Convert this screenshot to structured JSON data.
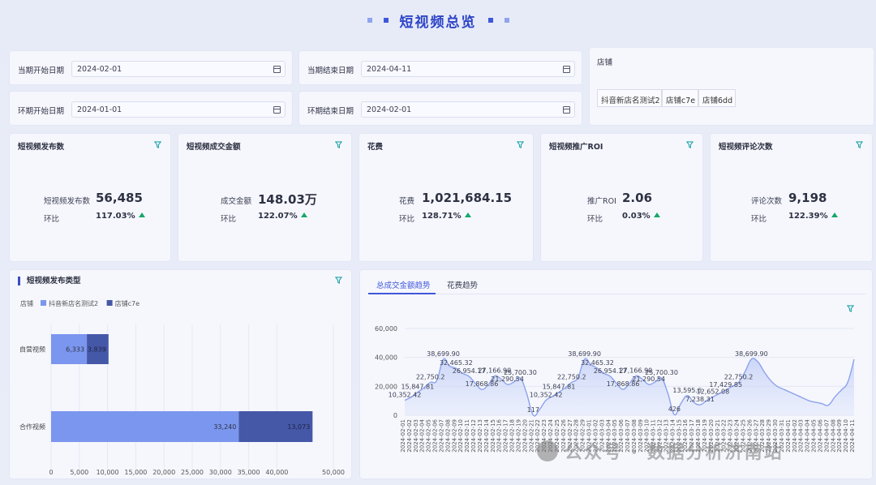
{
  "page_title": "短视频总览",
  "filters": {
    "current_start_label": "当期开始日期",
    "current_start_value": "2024-02-01",
    "current_end_label": "当期结束日期",
    "current_end_value": "2024-04-11",
    "prev_start_label": "环期开始日期",
    "prev_start_value": "2024-01-01",
    "prev_end_label": "环期结束日期",
    "prev_end_value": "2024-02-01"
  },
  "store": {
    "title": "店铺",
    "options": [
      "抖音新店名测试2",
      "店铺c7e",
      "店铺6dd"
    ]
  },
  "kpis": [
    {
      "title": "短视频发布数",
      "label": "短视频发布数",
      "value": "56,485",
      "ratio_label": "环比",
      "ratio": "117.03%"
    },
    {
      "title": "短视频成交金额",
      "label": "成交金额",
      "value": "148.03万",
      "ratio_label": "环比",
      "ratio": "122.07%"
    },
    {
      "title": "花费",
      "label": "花费",
      "value": "1,021,684.15",
      "ratio_label": "环比",
      "ratio": "128.71%"
    },
    {
      "title": "短视频推广ROI",
      "label": "推广ROI",
      "value": "2.06",
      "ratio_label": "环比",
      "ratio": "0.03%"
    },
    {
      "title": "短视频评论次数",
      "label": "评论次数",
      "value": "9,198",
      "ratio_label": "环比",
      "ratio": "122.39%"
    }
  ],
  "bar_section": {
    "title": "短视频发布类型",
    "legend_title": "店铺"
  },
  "trend_section": {
    "tabs": [
      "总成交金额趋势",
      "花费趋势"
    ],
    "active_tab": 0
  },
  "watermark": "公众号 · 数据分析济南站",
  "colors": {
    "series1": "#7b96ee",
    "series2": "#4558a8",
    "line": "#8ca3ec",
    "accent": "#3f58d9",
    "up": "#16a86a"
  },
  "chart_data": [
    {
      "type": "bar",
      "orientation": "horizontal",
      "stacked": true,
      "categories": [
        "自营视频",
        "合作视频"
      ],
      "series": [
        {
          "name": "抖音新店名测试2",
          "values": [
            6333,
            33240
          ]
        },
        {
          "name": "店铺c7e",
          "values": [
            3839,
            13073
          ]
        }
      ],
      "data_labels": [
        [
          "6,333",
          "33,240"
        ],
        [
          "3,839",
          "13,073"
        ]
      ],
      "xlim": [
        0,
        50000
      ],
      "xticks": [
        "0",
        "5,000",
        "10,000",
        "15,000",
        "20,000",
        "25,000",
        "30,000",
        "35,000",
        "40,000",
        "50,000"
      ],
      "xtick_values": [
        0,
        5000,
        10000,
        15000,
        20000,
        25000,
        30000,
        35000,
        40000,
        50000
      ],
      "legend": "top-left",
      "grid": true
    },
    {
      "type": "area",
      "ylim": [
        0,
        60000
      ],
      "yticks": [
        "0",
        "20,000",
        "40,000",
        "60,000"
      ],
      "ytick_values": [
        0,
        20000,
        40000,
        60000
      ],
      "x": [
        "2024-02-01",
        "2024-02-02",
        "2024-02-03",
        "2024-02-04",
        "2024-02-05",
        "2024-02-06",
        "2024-02-07",
        "2024-02-08",
        "2024-02-09",
        "2024-02-10",
        "2024-02-11",
        "2024-02-12",
        "2024-02-13",
        "2024-02-14",
        "2024-02-15",
        "2024-02-16",
        "2024-02-17",
        "2024-02-18",
        "2024-02-19",
        "2024-02-20",
        "2024-02-21",
        "2024-02-22",
        "2024-02-23",
        "2024-02-24",
        "2024-02-25",
        "2024-02-26",
        "2024-02-27",
        "2024-02-28",
        "2024-02-29",
        "2024-03-01",
        "2024-03-02",
        "2024-03-03",
        "2024-03-04",
        "2024-03-05",
        "2024-03-06",
        "2024-03-07",
        "2024-03-08",
        "2024-03-09",
        "2024-03-10",
        "2024-03-11",
        "2024-03-12",
        "2024-03-13",
        "2024-03-14",
        "2024-03-15",
        "2024-03-16",
        "2024-03-17",
        "2024-03-18",
        "2024-03-19",
        "2024-03-20",
        "2024-03-21",
        "2024-03-22",
        "2024-03-23",
        "2024-03-24",
        "2024-03-25",
        "2024-03-26",
        "2024-03-27",
        "2024-03-28",
        "2024-03-29",
        "2024-03-30",
        "2024-03-31",
        "2024-04-01",
        "2024-04-02",
        "2024-04-03",
        "2024-04-04",
        "2024-04-05",
        "2024-04-06",
        "2024-04-07",
        "2024-04-08",
        "2024-04-09",
        "2024-04-10",
        "2024-04-11"
      ],
      "values": [
        10352.42,
        12500,
        15847.81,
        19000,
        22750.2,
        24000,
        38699.9,
        34000,
        32465.32,
        29000,
        26954.17,
        22000,
        17868.86,
        21000,
        27166.9,
        25000,
        21290.54,
        23000,
        25700.3,
        15000,
        117,
        4000,
        10352.42,
        13000,
        15847.81,
        19000,
        22750.2,
        26000,
        38699.9,
        35000,
        32465.32,
        29000,
        26954.17,
        22000,
        17868.86,
        22000,
        27166.9,
        25000,
        21290.54,
        23000,
        25700.3,
        15000,
        426,
        8000,
        13595.6,
        9000,
        7238.31,
        10000,
        12652.08,
        15000,
        17429.85,
        20000,
        22750.2,
        30000,
        38699.9,
        37000,
        30000,
        24000,
        20000,
        18000,
        16000,
        14000,
        12000,
        10000,
        9000,
        8000,
        7000,
        12652.08,
        17429.85,
        22750.2,
        38699.9
      ],
      "point_labels": [
        {
          "i": 0,
          "text": "10,352.42"
        },
        {
          "i": 2,
          "text": "15,847.81"
        },
        {
          "i": 4,
          "text": "22,750.2"
        },
        {
          "i": 6,
          "text": "38,699.90"
        },
        {
          "i": 8,
          "text": "32,465.32"
        },
        {
          "i": 10,
          "text": "26,954.17"
        },
        {
          "i": 12,
          "text": "17,868.86"
        },
        {
          "i": 14,
          "text": "27,166.90"
        },
        {
          "i": 16,
          "text": "21,290.54"
        },
        {
          "i": 18,
          "text": "25,700.30"
        },
        {
          "i": 20,
          "text": "117"
        },
        {
          "i": 22,
          "text": "10,352.42"
        },
        {
          "i": 24,
          "text": "15,847.81"
        },
        {
          "i": 26,
          "text": "22,750.2"
        },
        {
          "i": 28,
          "text": "38,699.90"
        },
        {
          "i": 30,
          "text": "32,465.32"
        },
        {
          "i": 32,
          "text": "26,954.17"
        },
        {
          "i": 34,
          "text": "17,868.86"
        },
        {
          "i": 36,
          "text": "27,166.90"
        },
        {
          "i": 38,
          "text": "21,290.54"
        },
        {
          "i": 40,
          "text": "25,700.30"
        },
        {
          "i": 42,
          "text": "426"
        },
        {
          "i": 44,
          "text": "13,595.6"
        },
        {
          "i": 46,
          "text": "7,238.31"
        },
        {
          "i": 48,
          "text": "12,652.08"
        },
        {
          "i": 50,
          "text": "17,429.85"
        },
        {
          "i": 52,
          "text": "22,750.2"
        },
        {
          "i": 54,
          "text": "38,699.90"
        }
      ],
      "grid": true
    }
  ]
}
